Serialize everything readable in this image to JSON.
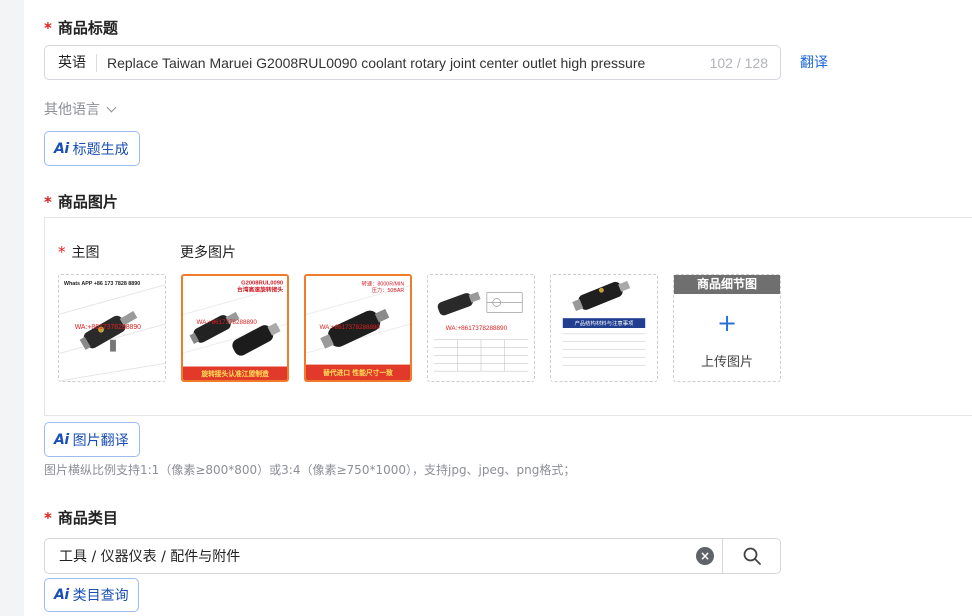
{
  "title_section": {
    "required_mark": "*",
    "label": "商品标题",
    "lang_prefix": "英语",
    "title_value": "Replace Taiwan Maruei G2008RUL0090 coolant rotary joint center outlet high pressure",
    "char_count": "102 / 128",
    "translate_link": "翻译",
    "other_languages": "其他语言",
    "ai_button_icon": "Ai",
    "ai_button_label": "标题生成"
  },
  "images_section": {
    "required_mark": "*",
    "label": "商品图片",
    "main_image_label": "主图",
    "more_images_label": "更多图片",
    "thumbnails": [
      {
        "icon": "product-photo-icon",
        "text_top": "Whats APP +86 173 7828 8890",
        "text_mid": "WA:+8617378288890",
        "text_bottom": ""
      },
      {
        "icon": "product-photo-icon",
        "text_top": "G2008RUL0090\n台湾高速旋转接头",
        "text_mid": "WA:+8617378288890",
        "text_bottom": "旋转接头认准江盟制造"
      },
      {
        "icon": "product-photo-icon",
        "text_top": "转速：8000R/MIN\n压力：50BAR",
        "text_mid": "WA:+8617378288890",
        "text_bottom": "替代进口 性能尺寸一致"
      },
      {
        "icon": "product-drawing-icon",
        "text_top": "",
        "text_mid": "WA:+8617378288890",
        "text_bottom": ""
      },
      {
        "icon": "product-photo-icon",
        "text_top": "",
        "text_mid": "产品结构材料与注意事项",
        "text_bottom": ""
      }
    ],
    "upload_header": "商品细节图",
    "upload_label": "上传图片",
    "ai_button_icon": "Ai",
    "ai_button_label": "图片翻译",
    "hint": "图片横纵比例支持1:1（像素≥800*800）或3:4（像素≥750*1000），支持jpg、jpeg、png格式；"
  },
  "category_section": {
    "required_mark": "*",
    "label": "商品类目",
    "value": "工具 / 仪器仪表 / 配件与附件",
    "clear_icon": "×",
    "ai_button_icon": "Ai",
    "ai_button_label": "类目查询"
  },
  "colors": {
    "accent": "#1a66d6",
    "required": "#e02020",
    "orange_border": "#ef7b2b"
  }
}
